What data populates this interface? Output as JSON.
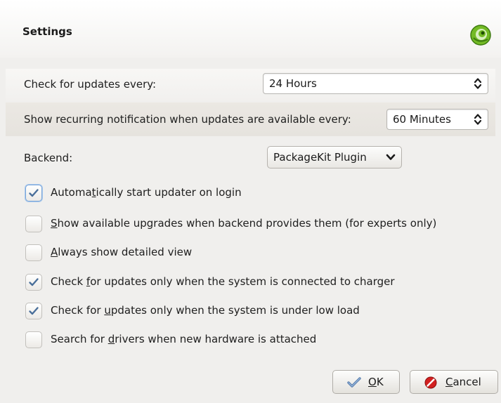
{
  "dialog": {
    "title": "Settings",
    "logo_icon": "opensuse-logo-icon"
  },
  "check_interval": {
    "label": "Check for updates every:",
    "value": "24 Hours"
  },
  "notification_interval": {
    "label": "Show recurring notification when updates are available every:",
    "value": "60 Minutes"
  },
  "backend": {
    "label": "Backend:",
    "value": "PackageKit Plugin"
  },
  "options": [
    {
      "pre": "Automa",
      "acc": "t",
      "post": "ically start updater on login",
      "checked": true
    },
    {
      "pre": "",
      "acc": "S",
      "post": "how available upgrades when backend provides them (for experts only)",
      "checked": false
    },
    {
      "pre": "",
      "acc": "A",
      "post": "lways show detailed view",
      "checked": false
    },
    {
      "pre": "Check ",
      "acc": "f",
      "post": "or updates only when the system is connected to charger",
      "checked": true
    },
    {
      "pre": "Check for ",
      "acc": "u",
      "post": "pdates only when the system is under low load",
      "checked": true
    },
    {
      "pre": "Search for ",
      "acc": "d",
      "post": "rivers when new hardware is attached",
      "checked": false
    }
  ],
  "buttons": {
    "ok": {
      "acc": "O",
      "rest": "K",
      "icon": "checkmark-icon"
    },
    "cancel": {
      "acc": "C",
      "rest": "ancel",
      "icon": "cancel-icon"
    }
  },
  "colors": {
    "check_mark": "#4a6f9a",
    "logo_green": "#73ba25",
    "cancel_red": "#d22020"
  }
}
